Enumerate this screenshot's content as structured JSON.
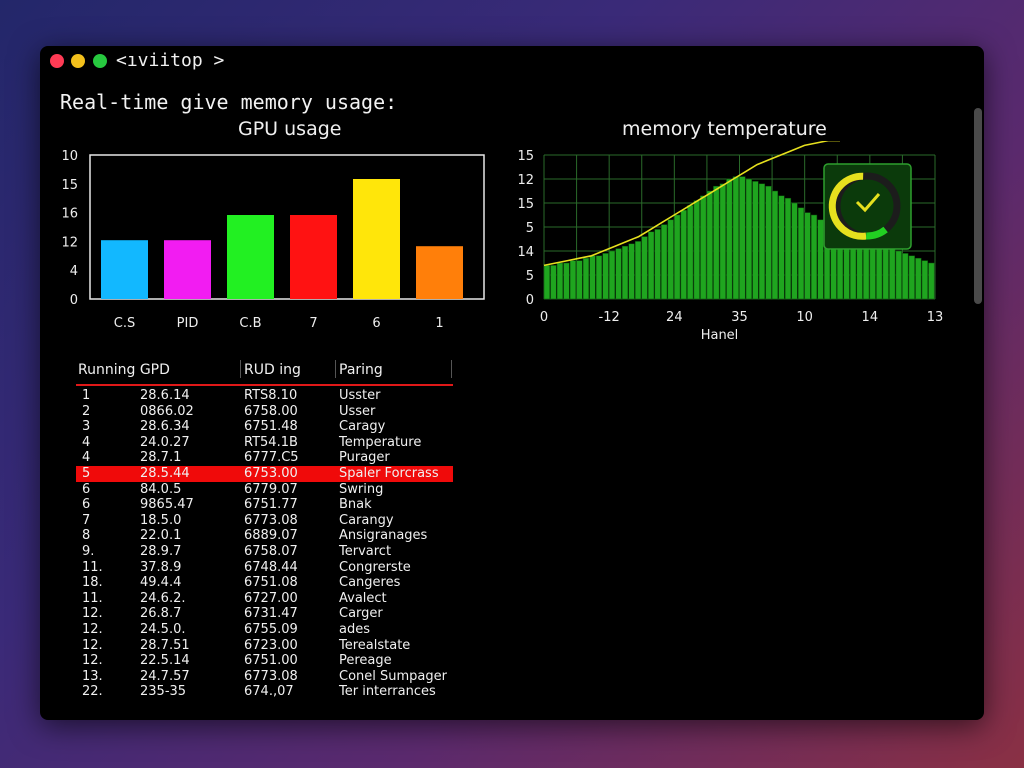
{
  "window": {
    "title": "<ıviitop >"
  },
  "heading": "Real-time give memory usage:",
  "gpu_chart": {
    "title": "GPU usage",
    "bar_colors": [
      "#12b8ff",
      "#f21cf2",
      "#22f022",
      "#ff1212",
      "#ffe60a",
      "#ff7f0a"
    ]
  },
  "mem_chart": {
    "title": "memory temperature",
    "bar_color": "#1fa51f",
    "line_color": "#e6e01e",
    "gauge_colors": [
      "#e6e01e",
      "#22d022"
    ]
  },
  "chart_data": [
    {
      "type": "bar",
      "title": "GPU usage",
      "categories": [
        "C.S",
        "PID",
        "C.B",
        "7",
        "6",
        "1"
      ],
      "y_tick_labels": [
        "10",
        "15",
        "16",
        "12",
        "4",
        "0"
      ],
      "values": [
        4.9,
        4.9,
        7.0,
        7.0,
        10.0,
        4.4
      ],
      "ylim": [
        0,
        12
      ],
      "grid": false
    },
    {
      "type": "area",
      "title": "memory temperature",
      "xlabel": "Hanel",
      "x_tick_labels": [
        "0",
        "-12",
        "24",
        "35",
        "10",
        "14",
        "13"
      ],
      "y_tick_labels": [
        "15",
        "12",
        "15",
        "5",
        "14",
        "5",
        "0"
      ],
      "values": [
        14,
        14,
        15,
        15,
        16,
        16,
        17,
        18,
        18,
        19,
        20,
        21,
        22,
        23,
        24,
        26,
        28,
        29,
        31,
        33,
        35,
        37,
        39,
        41,
        43,
        45,
        47,
        48,
        50,
        51,
        51,
        50,
        49,
        48,
        47,
        45,
        43,
        42,
        40,
        38,
        36,
        35,
        33,
        32,
        30,
        29,
        28,
        27,
        26,
        25,
        24,
        23,
        22,
        21,
        20,
        19,
        18,
        17,
        16,
        15
      ],
      "line": [
        14,
        15,
        16,
        17,
        18,
        20,
        22,
        24,
        26,
        29,
        32,
        35,
        38,
        41,
        44,
        47,
        50,
        53,
        56,
        58,
        60,
        62,
        64,
        65,
        66,
        66
      ],
      "ylim": [
        0,
        60
      ],
      "grid": true
    }
  ],
  "process_table": {
    "headers": [
      "Running GPD",
      "RUD ing",
      "Paring"
    ],
    "rows": [
      [
        "1",
        "28.6.14",
        "RTS8.10",
        "Usster"
      ],
      [
        "2",
        "0866.02",
        "6758.00",
        "Usser"
      ],
      [
        "3",
        "28.6.34",
        "6751.48",
        "Caragy"
      ],
      [
        "4",
        "24.0.27",
        "RT54.1B",
        "Temperature"
      ],
      [
        "4",
        "28.7.1",
        "6777.C5",
        "Purager"
      ],
      [
        "5",
        "28.5.44",
        "6753.00",
        "Spaler Forcrass"
      ],
      [
        "6",
        "84.0.5",
        "6779.07",
        "Swring"
      ],
      [
        "6",
        "9865.47",
        "6751.77",
        "Bnak"
      ],
      [
        "7",
        "18.5.0",
        "6773.08",
        "Carangy"
      ],
      [
        "8",
        "22.0.1",
        "6889.07",
        "Ansigranages"
      ],
      [
        "9.",
        "28.9.7",
        "6758.07",
        "Tervarct"
      ],
      [
        "11.",
        "37.8.9",
        "6748.44",
        "Congrerste"
      ],
      [
        "18.",
        "49.4.4",
        "6751.08",
        "Cangeres"
      ],
      [
        "11.",
        "24.6.2.",
        "6727.00",
        "Avalect"
      ],
      [
        "12.",
        "26.8.7",
        "6731.47",
        "Carger"
      ],
      [
        "12.",
        "24.5.0.",
        "6755.09",
        "ades"
      ],
      [
        "12.",
        "28.7.51",
        "6723.00",
        "Terealstate"
      ],
      [
        "12.",
        "22.5.14",
        "6751.00",
        "Pereage"
      ],
      [
        "13.",
        "24.7.57",
        "6773.08",
        "Conel Sumpager"
      ],
      [
        "22.",
        "235-35",
        "674.,07",
        "Ter interrances"
      ]
    ],
    "highlight_color": "#f00a0a"
  }
}
